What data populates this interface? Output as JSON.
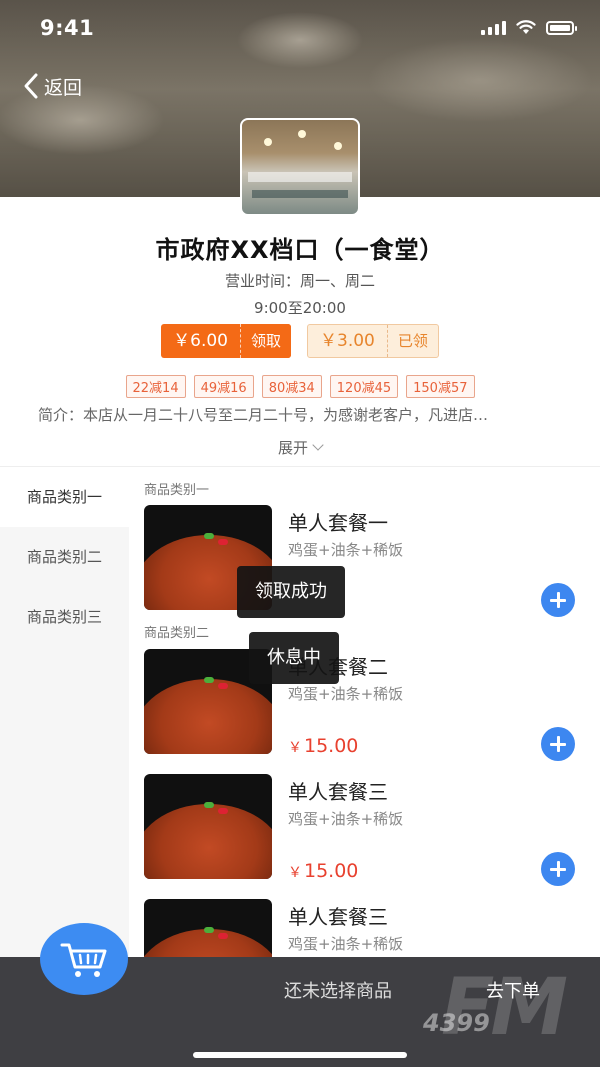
{
  "status_bar": {
    "time": "9:41"
  },
  "nav": {
    "back_label": "返回"
  },
  "store": {
    "name": "市政府XX档口（一食堂）",
    "hours_label": "营业时间：周一、周二",
    "time_range": "9:00至20:00",
    "intro": "简介：本店从一月二十八号至二月二十号，为感谢老客户，凡进店…",
    "expand_label": "展开"
  },
  "coupons": [
    {
      "amount": "￥6.00",
      "action": "领取",
      "state": "available"
    },
    {
      "amount": "￥3.00",
      "action": "已领",
      "state": "claimed"
    }
  ],
  "discounts": [
    "22减14",
    "49减16",
    "80减34",
    "120减45",
    "150减57"
  ],
  "categories": [
    "商品类别一",
    "商品类别二",
    "商品类别三"
  ],
  "sections": [
    {
      "title": "商品类别一"
    },
    {
      "title": "商品类别二"
    }
  ],
  "items": [
    {
      "name": "单人套餐一",
      "desc": "鸡蛋+油条+稀饭",
      "price": ""
    },
    {
      "name": "单人套餐二",
      "desc": "鸡蛋+油条+稀饭",
      "price_currency": "￥",
      "price_value": "15.00"
    },
    {
      "name": "单人套餐三",
      "desc": "鸡蛋+油条+稀饭",
      "price_currency": "￥",
      "price_value": "15.00"
    },
    {
      "name": "单人套餐三",
      "desc": "鸡蛋+油条+稀饭"
    }
  ],
  "toasts": {
    "claimed": "领取成功",
    "closed": "休息中"
  },
  "cart": {
    "empty_text": "还未选择商品",
    "checkout_label": "去下单"
  },
  "watermark": {
    "main": "FM",
    "sub": "4399"
  },
  "colors": {
    "accent_blue": "#3d87f0",
    "coupon_orange": "#f46a16",
    "price_red": "#e8412f",
    "bottom_bar": "#3f3f43"
  }
}
